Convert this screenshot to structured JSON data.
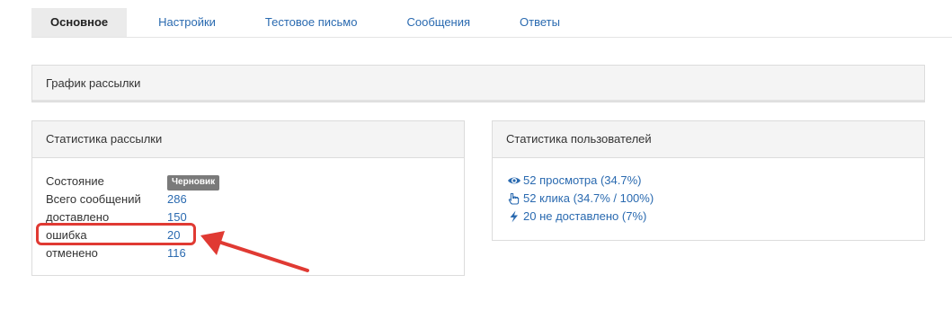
{
  "tabs": [
    {
      "label": "Основное",
      "active": true
    },
    {
      "label": "Настройки",
      "active": false
    },
    {
      "label": "Тестовое письмо",
      "active": false
    },
    {
      "label": "Сообщения",
      "active": false
    },
    {
      "label": "Ответы",
      "active": false
    }
  ],
  "schedule_panel": {
    "title": "График рассылки"
  },
  "stats_panel": {
    "title": "Статистика рассылки",
    "rows": [
      {
        "label": "Состояние",
        "value": "Черновик"
      },
      {
        "label": "Всего сообщений",
        "value": "286"
      },
      {
        "label": "доставлено",
        "value": "150"
      },
      {
        "label": "ошибка",
        "value": "20"
      },
      {
        "label": "отменено",
        "value": "116"
      }
    ]
  },
  "users_panel": {
    "title": "Статистика пользователей",
    "rows": [
      {
        "icon": "eye-icon",
        "text": "52 просмотра (34.7%)"
      },
      {
        "icon": "pointer-hand-icon",
        "text": "52 клика (34.7% / 100%)"
      },
      {
        "icon": "lightning-icon",
        "text": "20 не доставлено (7%)"
      }
    ]
  },
  "colors": {
    "link": "#2a6ab0",
    "highlight": "#e03a33",
    "badge": "#7a7a7a"
  }
}
